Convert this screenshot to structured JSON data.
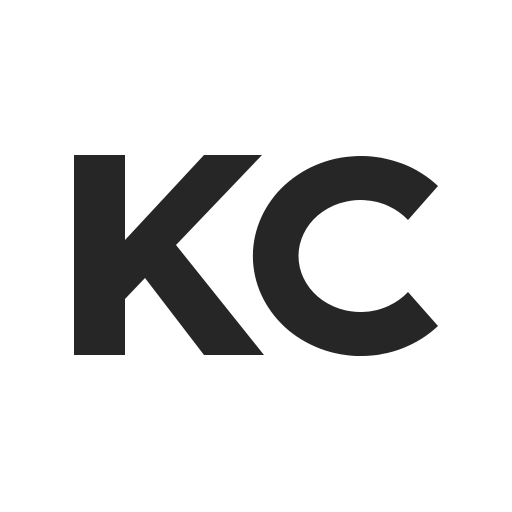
{
  "logo": {
    "text": "KC",
    "color": "#262626",
    "background": "#ffffff"
  }
}
